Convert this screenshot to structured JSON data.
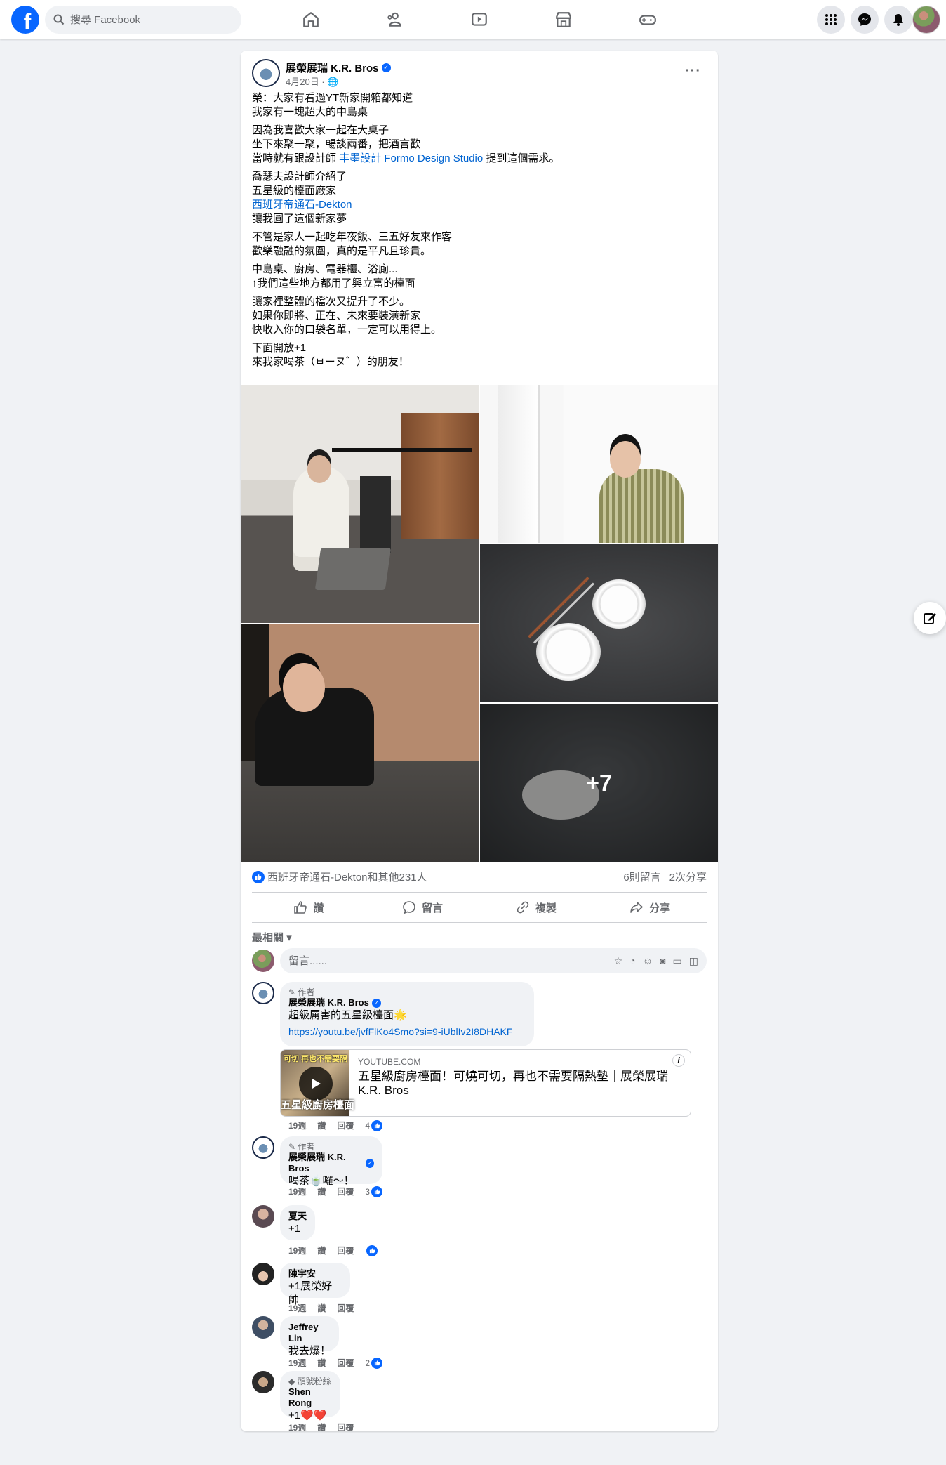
{
  "topbar": {
    "search_placeholder": "搜尋 Facebook",
    "nav": [
      "home-icon",
      "friends-icon",
      "video-icon",
      "marketplace-icon",
      "gaming-icon"
    ]
  },
  "post": {
    "page_name": "展榮展瑞 K.R. Bros",
    "date": "4月20日 · ",
    "paragraphs": [
      [
        "榮：大家有看過YT新家開箱都知道",
        "我家有一塊超大的中島桌"
      ],
      [
        "因為我喜歡大家一起在大桌子",
        "坐下來聚一聚，暢談兩番，把酒言歡"
      ],
      [
        "喬瑟夫設計師介紹了",
        "五星級的檯面廠家"
      ],
      [
        "讓我圓了這個新家夢"
      ],
      [
        "不管是家人一起吃年夜飯、三五好友來作客",
        "歡樂融融的氛圍，真的是平凡且珍貴。"
      ],
      [
        "中島桌、廚房、電器櫃、浴廁...",
        "↑我們這些地方都用了興立富的檯面"
      ],
      [
        "讓家裡整體的檔次又提升了不少。",
        "如果你即將、正在、未來要裝潢新家",
        "快收入你的口袋名單，一定可以用得上。"
      ],
      [
        "下面開放+1",
        "來我家喝茶（ㅂーヌ゛）的朋友！"
      ]
    ],
    "p3_prefix": "當時就有跟設計師 ",
    "p3_link": "丰墨設計 Formo Design Studio",
    "p3_suffix": " 提到這個需求。",
    "p4_link": "西班牙帝通石-Dekton",
    "more_photos": "+7",
    "reactions_text": "西班牙帝通石-Dekton和其他231人",
    "comments_count": "6則留言",
    "shares_count": "2次分享",
    "actions": {
      "like": "讚",
      "comment": "留言",
      "copy": "複製",
      "share": "分享"
    },
    "sort_label": "最相關",
    "composer_placeholder": "留言......"
  },
  "comments": [
    {
      "badge": "作者",
      "name": "展榮展瑞 K.R. Bros",
      "text": "超級厲害的五星級檯面🌟",
      "link": "https://youtu.be/jvfFlKo4Smo?si=9-iUblIv2I8DHAKF",
      "time": "19週",
      "like": "讚",
      "reply": "回覆",
      "count": "4"
    },
    {
      "badge": "作者",
      "name": "展榮展瑞 K.R. Bros",
      "text": "喝茶🍵囉～！",
      "time": "19週",
      "like": "讚",
      "reply": "回覆",
      "count": "3"
    },
    {
      "name": "夏天",
      "text": "+1",
      "time": "19週",
      "like": "讚",
      "reply": "回覆",
      "count": ""
    },
    {
      "name": "陳宇安",
      "text": "+1展榮好帥",
      "time": "19週",
      "like": "讚",
      "reply": "回覆"
    },
    {
      "name": "Jeffrey Lin",
      "text": "我去爆！",
      "time": "19週",
      "like": "讚",
      "reply": "回覆",
      "count": "2"
    },
    {
      "badge": "頭號粉絲",
      "name": "Shen Rong",
      "text": "+1❤️❤️",
      "time": "19週",
      "like": "讚",
      "reply": "回覆"
    }
  ],
  "youtube": {
    "source": "YOUTUBE.COM",
    "title": "五星級廚房檯面！可燒可切，再也不需要隔熱墊｜展榮展瑞",
    "subtitle": "K.R. Bros",
    "thumb_top": "可切 再也不需要隔",
    "thumb_bottom": "五星級廚房檯面"
  }
}
